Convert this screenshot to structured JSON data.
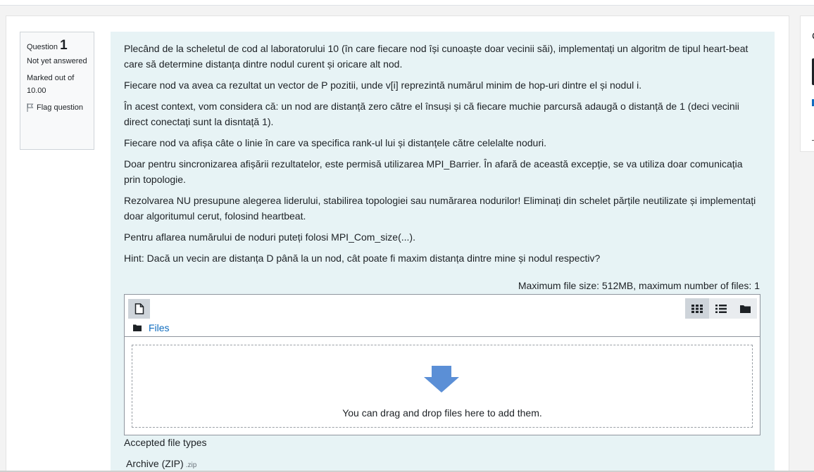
{
  "question": {
    "label": "Question",
    "number": "1",
    "status": "Not yet answered",
    "marked": "Marked out of 10.00",
    "flag_label": "Flag question"
  },
  "right_panel": {
    "letter": "C"
  },
  "paragraphs": [
    "Plecând de la scheletul de cod al laboratorului 10 (în care fiecare nod își cunoaște doar vecinii săi), implementați un algoritm de tipul heart-beat care să determine distanța dintre nodul curent și oricare alt nod.",
    "Fiecare nod va avea ca rezultat un vector de P pozitii, unde v[i] reprezintă numărul minim de hop-uri dintre el și nodul i.",
    "În acest context, vom considera că: un nod are distanță zero către el însuși și că fiecare muchie parcursă adaugă o distanță de 1 (deci vecinii direct conectați sunt la disntață 1).",
    "Fiecare nod va afișa câte o linie în care va specifica rank-ul lui și distanțele către celelalte noduri.",
    "Doar pentru sincronizarea afișării rezultatelor, este permisă utilizarea MPI_Barrier. În afară de această excepție, se va utiliza doar comunicația prin topologie.",
    "Rezolvarea NU presupune alegerea liderului, stabilirea topologiei sau numărarea nodurilor! Eliminați din schelet părțile neutilizate și implementați doar algoritumul cerut, folosind heartbeat.",
    "Pentru aflarea numărului de noduri puteți folosi MPI_Com_size(...).",
    "Hint: Dacă un vecin are distanța D până la un nod, cât poate fi maxim distanța dintre mine și nodul respectiv?"
  ],
  "filemanager": {
    "max_size_text": "Maximum file size: 512MB, maximum number of files: 1",
    "breadcrumb": "Files",
    "drop_text": "You can drag and drop files here to add them.",
    "icons": {
      "add": "add-file-icon",
      "grid": "grid-view-icon",
      "list": "list-view-icon",
      "tree": "folder-view-icon"
    }
  },
  "accepted": {
    "title": "Accepted file types",
    "item_label": "Archive (ZIP)",
    "item_ext": ".zip"
  },
  "colors": {
    "content_bg": "#e7f3f5",
    "link": "#0f6cbf",
    "arrow": "#5b8fd6"
  }
}
